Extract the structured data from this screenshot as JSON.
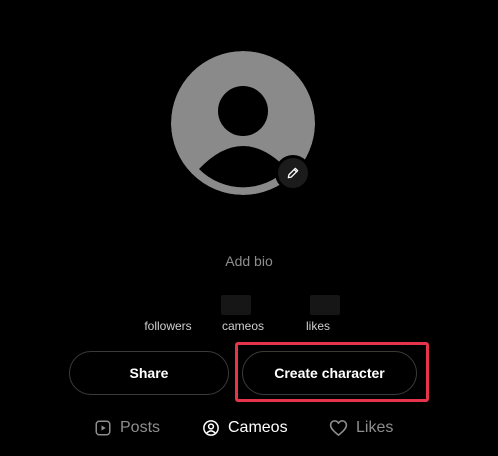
{
  "profile": {
    "bio_placeholder": "Add bio",
    "avatar_icon": "default-user-avatar",
    "edit_icon": "pencil-icon"
  },
  "stats": [
    {
      "label": "followers",
      "value": ""
    },
    {
      "label": "cameos",
      "value": ""
    },
    {
      "label": "likes",
      "value": ""
    }
  ],
  "actions": {
    "share_label": "Share",
    "create_character_label": "Create character"
  },
  "tabs": [
    {
      "label": "Posts",
      "icon": "play-square-icon",
      "active": false
    },
    {
      "label": "Cameos",
      "icon": "user-circle-icon",
      "active": true
    },
    {
      "label": "Likes",
      "icon": "heart-icon",
      "active": false
    }
  ],
  "colors": {
    "background": "#000000",
    "avatar": "#8a8a8a",
    "muted_text": "#8e8e8e",
    "highlight": "#e8344a"
  }
}
